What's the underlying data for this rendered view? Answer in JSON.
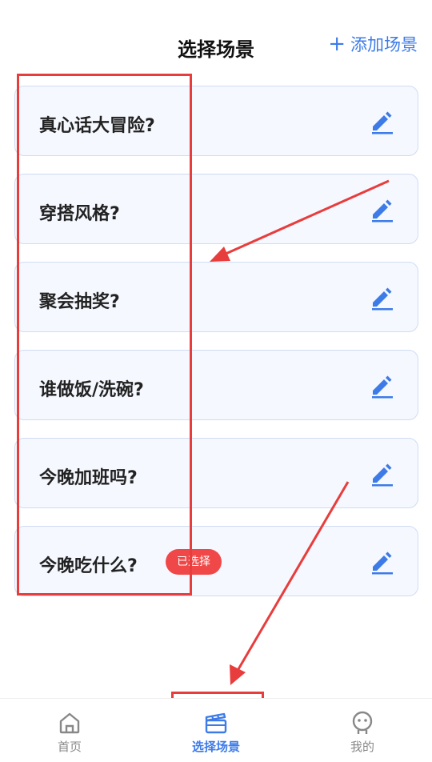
{
  "header": {
    "title": "选择场景",
    "add_label": "添加场景"
  },
  "scenes": [
    {
      "label": "真心话大冒险?",
      "selected": false
    },
    {
      "label": "穿搭风格?",
      "selected": false
    },
    {
      "label": "聚会抽奖?",
      "selected": false
    },
    {
      "label": "谁做饭/洗碗?",
      "selected": false
    },
    {
      "label": "今晚加班吗?",
      "selected": false
    },
    {
      "label": "今晚吃什么?",
      "selected": true
    }
  ],
  "selected_badge": "已选择",
  "tabbar": {
    "home": "首页",
    "scenes": "选择场景",
    "mine": "我的"
  },
  "colors": {
    "accent": "#3d7be8",
    "badge": "#f04848",
    "annotation": "#e83d3d",
    "card_bg": "#f5f8fe"
  }
}
